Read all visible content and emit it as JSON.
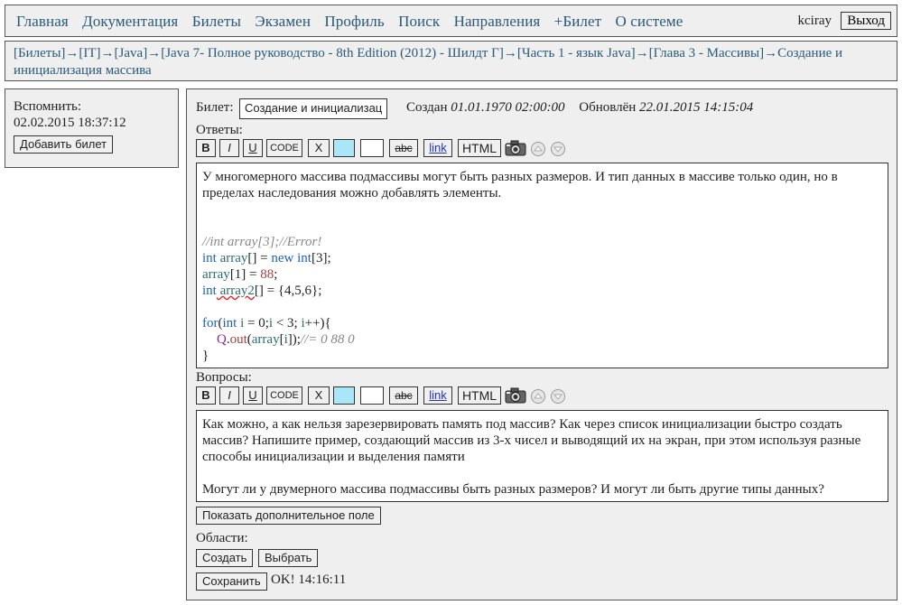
{
  "nav": {
    "links": [
      "Главная",
      "Документация",
      "Билеты",
      "Экзамен",
      "Профиль",
      "Поиск",
      "Направления",
      "+Билет",
      "О системе"
    ],
    "user": "kciray",
    "logout": "Выход"
  },
  "breadcrumb": "[Билеты]→[IT]→[Java]→[Java 7- Полное руководство - 8th Edition (2012) - Шилдт Г]→[Часть 1 - язык Java]→[Глава 3 - Массивы]→Создание и инициализация массива",
  "remind": {
    "label": "Вспомнить:",
    "date": "02.02.2015 18:37:12",
    "add_button": "Добавить билет"
  },
  "ticket": {
    "label": "Билет:",
    "name": "Создание и инициализац",
    "created_label": "Создан",
    "created": "01.01.1970 02:00:00",
    "updated_label": "Обновлён",
    "updated": "22.01.2015 14:15:04"
  },
  "toolbar": {
    "bold": "B",
    "italic": "I",
    "underline": "U",
    "code": "CODE",
    "x": "X",
    "strike": "abc",
    "link": "link",
    "html": "HTML",
    "color_cyan": "#a8e6f8",
    "color_white": "#ffffff"
  },
  "answers": {
    "label": "Ответы:",
    "text1": "У многомерного массива подмассивы могут быть разных размеров. И тип данных в массиве только один, но в пределах наследования можно добавлять элементы.",
    "code": {
      "l1": "//int array[3];//Error!",
      "l2a": "int",
      "l2b": " array",
      "l2c": "[] = ",
      "l2d": "new",
      "l2e": " int",
      "l2f": "[3];",
      "l3a": "array",
      "l3b": "[1] = ",
      "l3c": "88",
      "l3d": ";",
      "l4a": "int",
      "l4b": " array2",
      "l4c": "[] = {4,5,6};",
      "l5a": "for",
      "l5b": "(",
      "l5c": "int",
      "l5d": " i",
      "l5e": " = 0;",
      "l5f": "i",
      "l5g": " < 3; ",
      "l5h": "i",
      "l5i": "++){",
      "l6a": "Q",
      "l6b": ".",
      "l6c": "out",
      "l6d": "(",
      "l6e": "array",
      "l6f": "[",
      "l6g": "i",
      "l6h": "]);",
      "l6i": "//= 0 88 0",
      "l7": "}"
    }
  },
  "questions": {
    "label": "Вопросы:",
    "text1": "Как можно, а как нельзя зарезервировать память под массив? Как через список инициализации быстро создать массив? Напишите пример, создающий массив из 3-х чисел и выводящий их на экран, при этом используя разные способы инициализации и выделения памяти",
    "text2": "Могут ли у двумерного массива подмассивы быть разных размеров? И могут ли быть другие типы данных?"
  },
  "extra_button": "Показать дополнительное поле",
  "areas": {
    "label": "Области:",
    "create": "Создать",
    "select": "Выбрать"
  },
  "save": {
    "button": "Сохранить",
    "status": "OK! 14:16:11"
  }
}
